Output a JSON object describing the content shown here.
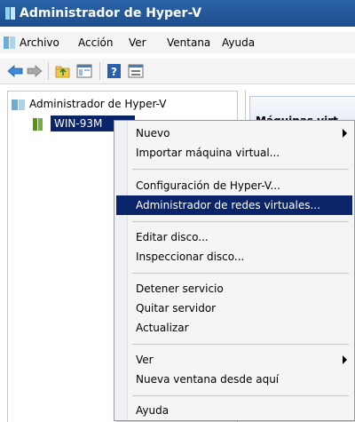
{
  "window": {
    "title": "Administrador de Hyper-V"
  },
  "menubar": {
    "items": [
      "Archivo",
      "Acción",
      "Ver",
      "Ventana",
      "Ayuda"
    ]
  },
  "toolbar": {
    "icons": [
      "back-arrow-icon",
      "forward-arrow-icon",
      "up-folder-icon",
      "show-hide-tree-icon",
      "help-icon",
      "properties-icon"
    ]
  },
  "tree": {
    "root_label": "Administrador de Hyper-V",
    "server_label": "WIN-93M"
  },
  "right_pane": {
    "header": "Máquinas virt"
  },
  "context_menu": {
    "items": [
      {
        "label": "Nuevo",
        "submenu": true
      },
      {
        "label": "Importar máquina virtual..."
      },
      {
        "label": "Configuración de Hyper-V..."
      },
      {
        "label": "Administrador de redes virtuales...",
        "selected": true
      },
      {
        "label": "Editar disco..."
      },
      {
        "label": "Inspeccionar disco..."
      },
      {
        "label": "Detener servicio"
      },
      {
        "label": "Quitar servidor"
      },
      {
        "label": "Actualizar"
      },
      {
        "label": "Ver",
        "submenu": true
      },
      {
        "label": "Nueva ventana desde aquí"
      },
      {
        "label": "Ayuda"
      }
    ]
  },
  "colors": {
    "title_bar": "#1d4f8e",
    "selection": "#0a246a",
    "menu_bg": "#f5f5f5"
  }
}
